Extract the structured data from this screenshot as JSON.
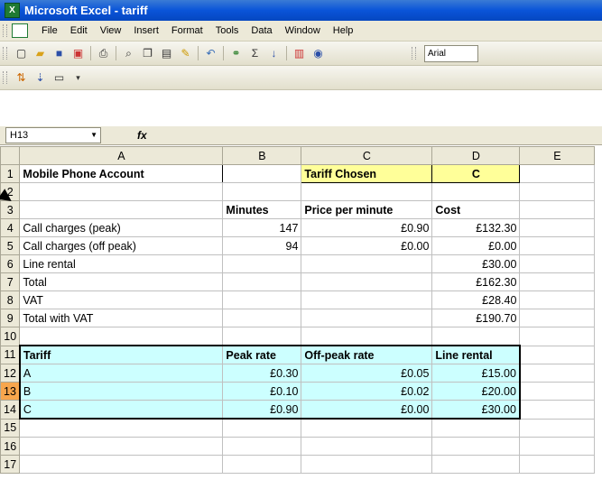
{
  "window": {
    "title": "Microsoft Excel - tariff"
  },
  "menu": [
    "File",
    "Edit",
    "View",
    "Insert",
    "Format",
    "Tools",
    "Data",
    "Window",
    "Help"
  ],
  "toolbar": {
    "font": "Arial"
  },
  "namebox": "H13",
  "fx": "fx",
  "columns": [
    "A",
    "B",
    "C",
    "D",
    "E"
  ],
  "rows": [
    [
      "1",
      "Mobile Phone Account",
      "",
      "Tariff Chosen",
      "C",
      ""
    ],
    [
      "2",
      "",
      "",
      "",
      "",
      ""
    ],
    [
      "3",
      "",
      "Minutes",
      "Price per minute",
      "Cost",
      ""
    ],
    [
      "4",
      "Call charges (peak)",
      "147",
      "£0.90",
      "£132.30",
      ""
    ],
    [
      "5",
      "Call charges (off peak)",
      "94",
      "£0.00",
      "£0.00",
      ""
    ],
    [
      "6",
      "Line rental",
      "",
      "",
      "£30.00",
      ""
    ],
    [
      "7",
      "Total",
      "",
      "",
      "£162.30",
      ""
    ],
    [
      "8",
      "VAT",
      "",
      "",
      "£28.40",
      ""
    ],
    [
      "9",
      "Total with VAT",
      "",
      "",
      "£190.70",
      ""
    ],
    [
      "10",
      "",
      "",
      "",
      "",
      ""
    ],
    [
      "11",
      "Tariff",
      "Peak rate",
      "Off-peak rate",
      "Line rental",
      ""
    ],
    [
      "12",
      "A",
      "£0.30",
      "£0.05",
      "£15.00",
      ""
    ],
    [
      "13",
      "B",
      "£0.10",
      "£0.02",
      "£20.00",
      ""
    ],
    [
      "14",
      "C",
      "£0.90",
      "£0.00",
      "£30.00",
      ""
    ],
    [
      "15",
      "",
      "",
      "",
      "",
      ""
    ],
    [
      "16",
      "",
      "",
      "",
      "",
      ""
    ],
    [
      "17",
      "",
      "",
      "",
      "",
      ""
    ]
  ]
}
